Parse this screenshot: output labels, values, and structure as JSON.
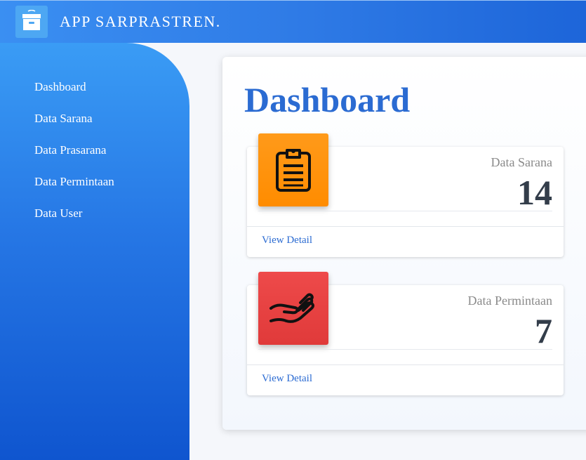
{
  "header": {
    "app_title": "APP SARPRASTREN.",
    "logo_icon": "archive-box-icon"
  },
  "sidebar": {
    "items": [
      {
        "label": "Dashboard"
      },
      {
        "label": "Data Sarana"
      },
      {
        "label": "Data Prasarana"
      },
      {
        "label": "Data Permintaan"
      },
      {
        "label": "Data User"
      }
    ]
  },
  "main": {
    "title": "Dashboard",
    "cards": [
      {
        "label": "Data Sarana",
        "value": "14",
        "link": "View Detail",
        "icon": "clipboard-icon",
        "color": "#ff8c00"
      },
      {
        "label": "Data Permintaan",
        "value": "7",
        "link": "View Detail",
        "icon": "hand-open-icon",
        "color": "#e53935"
      }
    ]
  },
  "colors": {
    "primary": "#2b6bd2",
    "sidebar_top": "#3a9cf5",
    "sidebar_bottom": "#0f55cf"
  }
}
